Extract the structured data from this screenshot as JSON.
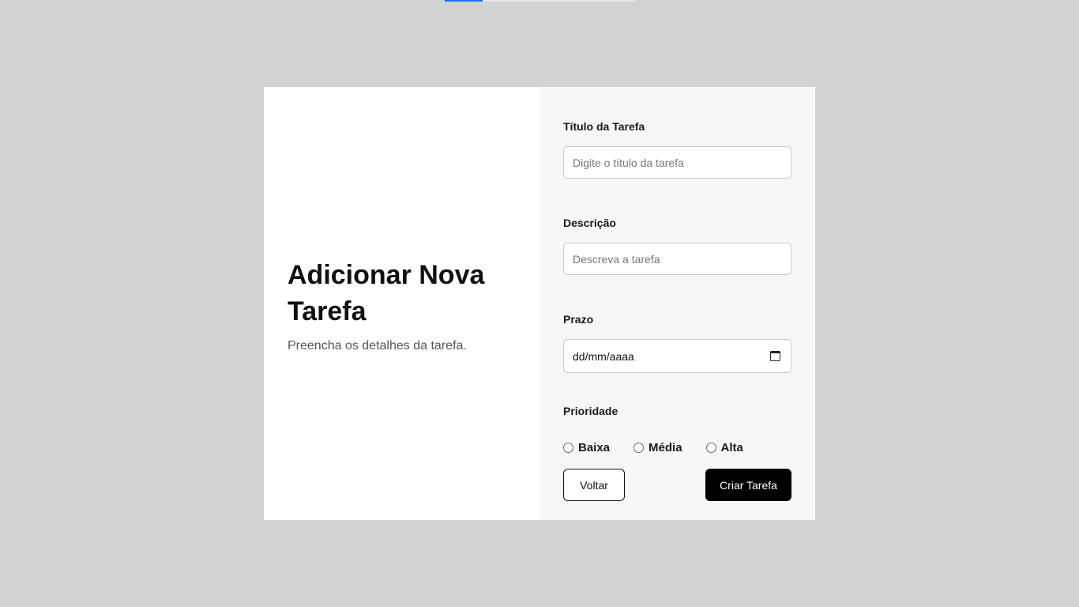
{
  "top_progress": {
    "fraction": 0.2
  },
  "colors": {
    "page_background": "#d3d3d3",
    "card_left_background": "#ffffff",
    "card_right_background": "#f7f7f7",
    "primary_button": "#000000",
    "progress_accent": "#1a73e8"
  },
  "intro": {
    "title": "Adicionar Nova Tarefa",
    "subtitle": "Preencha os detalhes da tarefa."
  },
  "form": {
    "title_field": {
      "label": "Título da Tarefa",
      "placeholder": "Digite o título da tarefa",
      "value": ""
    },
    "description_field": {
      "label": "Descrição",
      "placeholder": "Descreva a tarefa",
      "value": ""
    },
    "due_date_field": {
      "label": "Prazo",
      "display_value": "dd/mm/aaaa",
      "icon": "calendar-icon"
    },
    "priority": {
      "label": "Prioridade",
      "options": [
        {
          "label": "Baixa",
          "checked": false
        },
        {
          "label": "Média",
          "checked": false
        },
        {
          "label": "Alta",
          "checked": false
        }
      ]
    },
    "buttons": {
      "back_label": "Voltar",
      "create_label": "Criar Tarefa"
    }
  }
}
